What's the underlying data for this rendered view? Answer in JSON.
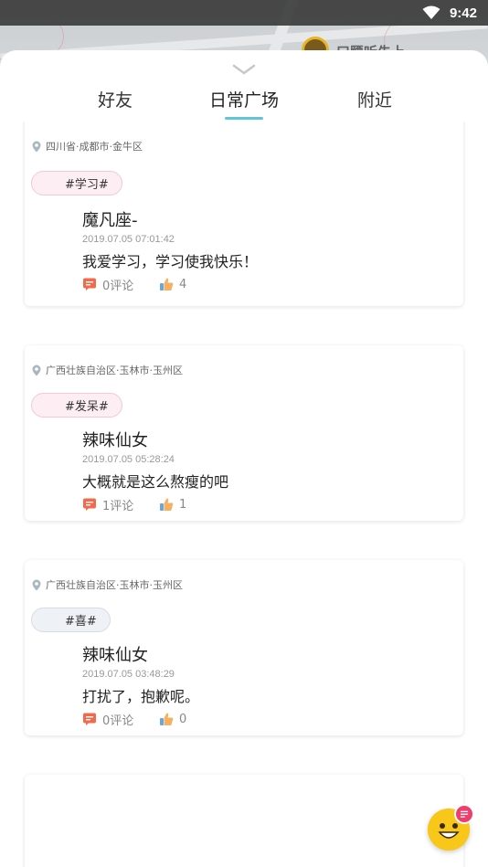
{
  "status_bar": {
    "time": "9:42"
  },
  "map": {
    "label": "口腰听先上"
  },
  "tabs": [
    {
      "label": "好友"
    },
    {
      "label": "日常广场",
      "active": true
    },
    {
      "label": "附近"
    }
  ],
  "posts": [
    {
      "location": "四川省·成都市·金牛区",
      "tag": "#学习#",
      "tag_style": "pink",
      "user": "魔凡座-",
      "time": "2019.07.05 07:01:42",
      "content": "我爱学习，学习使我快乐！",
      "comments": "0评论",
      "likes": "4"
    },
    {
      "location": "广西壮族自治区·玉林市·玉州区",
      "tag": "#发呆#",
      "tag_style": "pink",
      "user": "辣味仙女",
      "time": "2019.07.05 05:28:24",
      "content": "大概就是这么熬瘦的吧",
      "comments": "1评论",
      "likes": "1"
    },
    {
      "location": "广西壮族自治区·玉林市·玉州区",
      "tag": "#喜#",
      "tag_style": "gray",
      "user": "辣味仙女",
      "time": "2019.07.05 03:48:29",
      "content": "打扰了，抱歉呢。",
      "comments": "0评论",
      "likes": "0"
    }
  ],
  "icons": {
    "status": [
      "wifi-icon",
      "battery-icon"
    ],
    "sheet": "chevron-down-icon",
    "location": "location-pin-icon",
    "comment": "comment-icon",
    "like": "thumbs-up-icon",
    "fab": "smiley-chat-icon"
  },
  "colors": {
    "tab_underline": "#5ec6d6",
    "tag_pink_bg": "#fdeef4",
    "tag_gray_bg": "#eef1f6",
    "comment_icon": "#f06a4b",
    "like_icon": "#f5b062",
    "fab": "#f9c61a",
    "fab_badge": "#ef3e6c"
  }
}
